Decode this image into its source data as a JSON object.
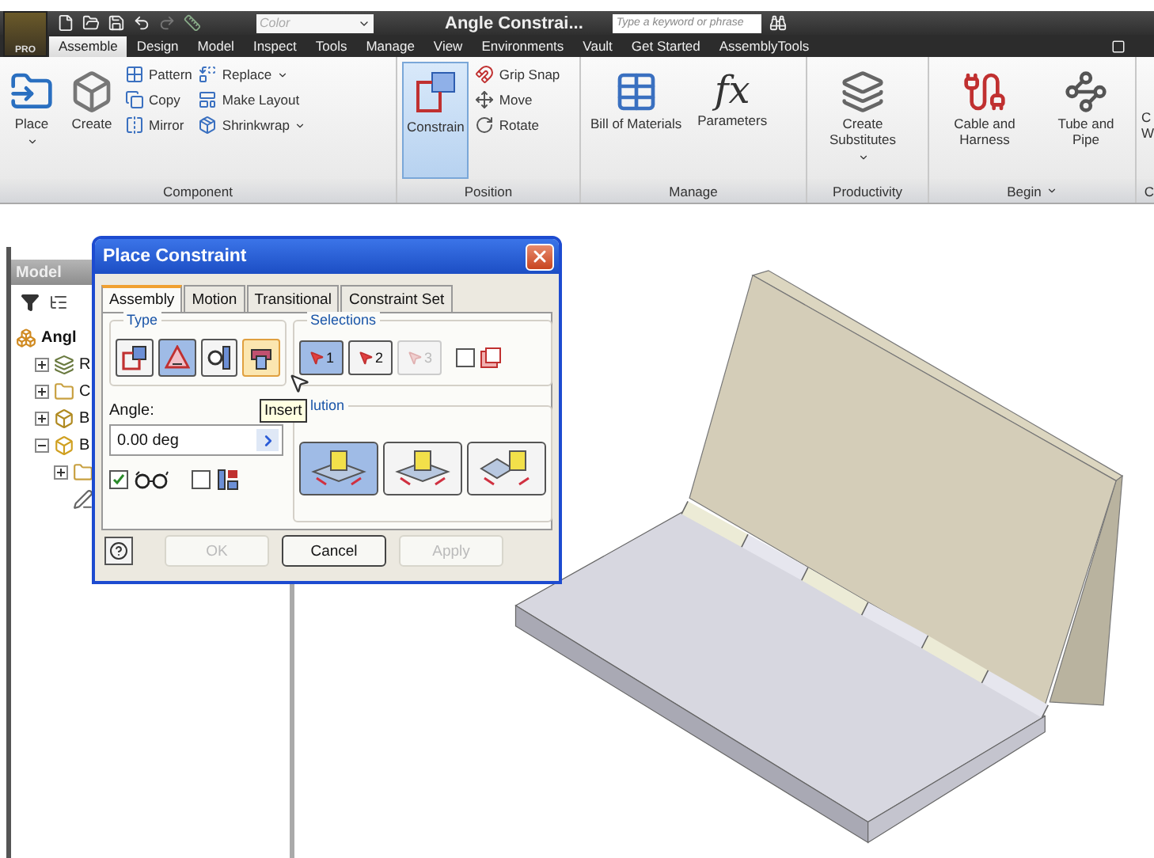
{
  "app_button": {
    "label": "PRO"
  },
  "style_box": {
    "value": "Color",
    "disabled": true
  },
  "title": "Angle Constrai...",
  "search": {
    "placeholder": "Type a keyword or phrase"
  },
  "ribbon_tabs": [
    {
      "label": "Assemble",
      "selected": true
    },
    {
      "label": "Design",
      "selected": false
    },
    {
      "label": "Model",
      "selected": false
    },
    {
      "label": "Inspect",
      "selected": false
    },
    {
      "label": "Tools",
      "selected": false
    },
    {
      "label": "Manage",
      "selected": false
    },
    {
      "label": "View",
      "selected": false
    },
    {
      "label": "Environments",
      "selected": false
    },
    {
      "label": "Vault",
      "selected": false
    },
    {
      "label": "Get Started",
      "selected": false
    },
    {
      "label": "AssemblyTools",
      "selected": false
    }
  ],
  "panels": [
    {
      "title": "Component",
      "dropdown": false,
      "groups": [
        {
          "kind": "large",
          "label": "Place",
          "dropdown": true,
          "active": false
        },
        {
          "kind": "large",
          "label": "Create",
          "dropdown": false,
          "active": false
        },
        {
          "kind": "stack",
          "items": [
            {
              "label": "Pattern",
              "dropdown": false
            },
            {
              "label": "Copy",
              "dropdown": false
            },
            {
              "label": "Mirror",
              "dropdown": false
            }
          ]
        },
        {
          "kind": "stack",
          "items": [
            {
              "label": "Replace",
              "dropdown": true
            },
            {
              "label": "Make Layout",
              "dropdown": false
            },
            {
              "label": "Shrinkwrap",
              "dropdown": true
            }
          ]
        }
      ]
    },
    {
      "title": "Position",
      "dropdown": false,
      "groups": [
        {
          "kind": "large",
          "label": "Constrain",
          "dropdown": false,
          "active": true
        },
        {
          "kind": "stack",
          "items": [
            {
              "label": "Grip Snap",
              "dropdown": false
            },
            {
              "label": "Move",
              "dropdown": false
            },
            {
              "label": "Rotate",
              "dropdown": false
            }
          ]
        }
      ]
    },
    {
      "title": "Manage",
      "dropdown": false,
      "groups": [
        {
          "kind": "large",
          "label": "Bill of Materials",
          "dropdown": false,
          "active": false
        },
        {
          "kind": "large",
          "label": "Parameters",
          "glyph": "fx",
          "dropdown": false,
          "active": false
        }
      ]
    },
    {
      "title": "Productivity",
      "dropdown": false,
      "groups": [
        {
          "kind": "large",
          "label": "Create Substitutes",
          "dropdown": true,
          "active": false
        }
      ]
    },
    {
      "title": "Begin",
      "dropdown": true,
      "groups": [
        {
          "kind": "large",
          "label": "Cable and Harness",
          "dropdown": false,
          "active": false
        },
        {
          "kind": "large",
          "label": "Tube and Pipe",
          "dropdown": false,
          "active": false
        }
      ]
    },
    {
      "title": "C",
      "dropdown": false,
      "groups": [
        {
          "kind": "cut",
          "label": "C W"
        }
      ]
    }
  ],
  "browser": {
    "title": "Model",
    "tree": [
      {
        "label": "Angl",
        "kind": "assembly",
        "children": [
          {
            "label": "R",
            "kind": "representations",
            "expanded": false
          },
          {
            "label": "C",
            "kind": "folder",
            "expanded": false
          },
          {
            "label": "B",
            "kind": "origin",
            "expanded": false
          },
          {
            "label": "B",
            "kind": "part",
            "expanded": true,
            "children": [
              {
                "kind": "folder",
                "expanded": false
              },
              {
                "kind": "sketch"
              }
            ]
          }
        ]
      }
    ]
  },
  "dialog": {
    "title": "Place Constraint",
    "tabs": [
      {
        "label": "Assembly",
        "selected": true
      },
      {
        "label": "Motion",
        "selected": false
      },
      {
        "label": "Transitional",
        "selected": false
      },
      {
        "label": "Constraint Set",
        "selected": false
      }
    ],
    "type": {
      "title": "Type",
      "buttons": [
        {
          "selected": false,
          "hovered": false
        },
        {
          "selected": true,
          "hovered": false
        },
        {
          "selected": false,
          "hovered": false
        },
        {
          "selected": false,
          "hovered": true
        }
      ]
    },
    "tooltip": "Insert",
    "selections": {
      "title": "Selections",
      "buttons": [
        {
          "label": "1",
          "selected": true,
          "disabled": false
        },
        {
          "label": "2",
          "selected": false,
          "disabled": false
        },
        {
          "label": "3",
          "selected": false,
          "disabled": true
        }
      ],
      "checkbox": {
        "checked": false
      }
    },
    "angle": {
      "label": "Angle:",
      "value": "0.00 deg"
    },
    "solution": {
      "title": "lution",
      "buttons": [
        {
          "selected": true
        },
        {
          "selected": false
        },
        {
          "selected": false
        }
      ]
    },
    "options": [
      {
        "checked": true
      },
      {
        "checked": false
      }
    ],
    "buttons": [
      {
        "label": "OK",
        "disabled": true
      },
      {
        "label": "Cancel",
        "disabled": false
      },
      {
        "label": "Apply",
        "disabled": true
      }
    ]
  }
}
